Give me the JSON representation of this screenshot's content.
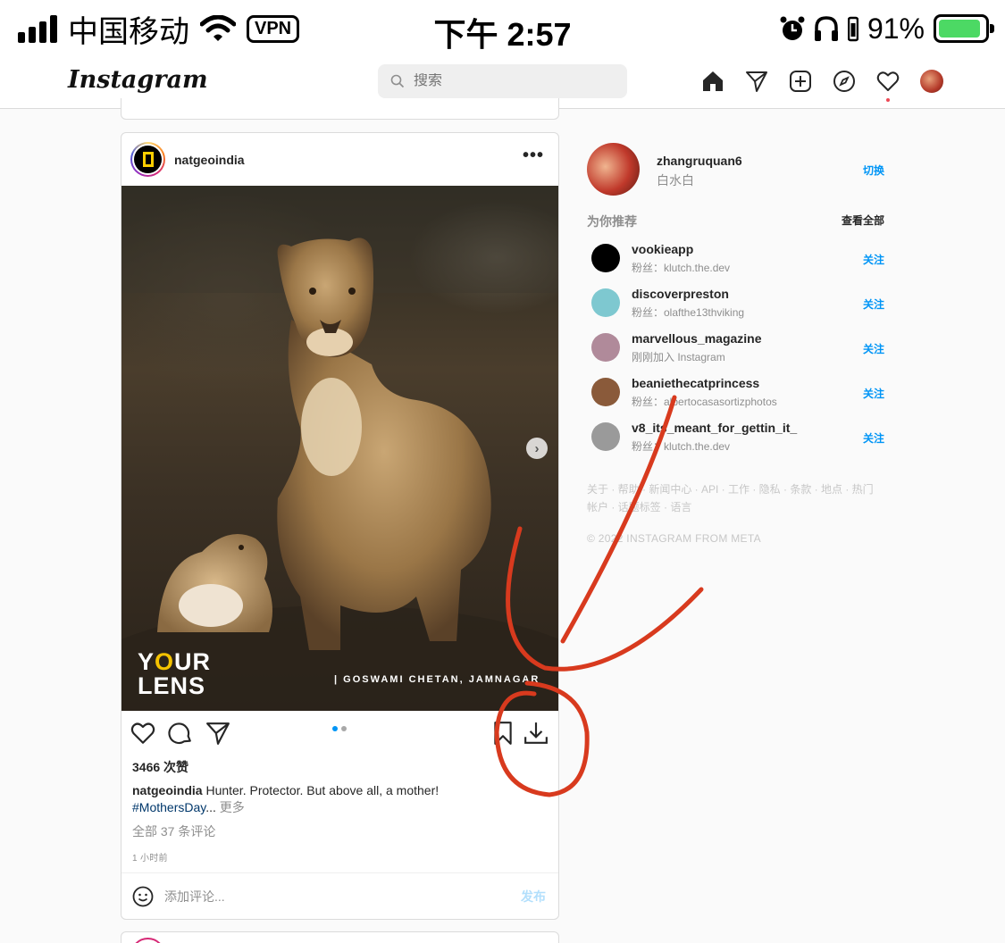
{
  "status_bar": {
    "carrier": "中国移动",
    "vpn": "VPN",
    "time": "下午 2:57",
    "battery_percent": "91%",
    "battery_level": 0.91
  },
  "header": {
    "logo": "Instagram",
    "search_placeholder": "搜索",
    "icons": [
      "home-icon",
      "direct-icon",
      "new-post-icon",
      "explore-icon",
      "activity-icon",
      "profile-avatar"
    ]
  },
  "post": {
    "username": "natgeoindia",
    "photo_credit": "| GOSWAMI CHETAN, JAMNAGAR",
    "watermark": {
      "line1_a": "Y",
      "line1_b": "O",
      "line1_c": "UR",
      "line2": "LENS"
    },
    "carousel_index": 1,
    "carousel_total": 2,
    "likes": "3466 次赞",
    "caption_user": "natgeoindia",
    "caption_text": "Hunter. Protector. But above all, a mother!",
    "hashtag": "#MothersDay",
    "ellipsis": "...",
    "more": "更多",
    "comments_link": "全部 37 条评论",
    "time_ago": "1 小时前",
    "comment_placeholder": "添加评论...",
    "publish": "发布"
  },
  "sidebar": {
    "me": {
      "username": "zhangruquan6",
      "name": "白水白",
      "switch": "切换"
    },
    "suggestions_title": "为你推荐",
    "see_all": "查看全部",
    "suggestions": [
      {
        "username": "vookieapp",
        "sub": "粉丝：klutch.the.dev",
        "action": "关注",
        "color": "#000000"
      },
      {
        "username": "discoverpreston",
        "sub": "粉丝：olafthe13thviking",
        "action": "关注",
        "color": "#7ec8d0"
      },
      {
        "username": "marvellous_magazine",
        "sub": "刚刚加入 Instagram",
        "action": "关注",
        "color": "#b08a9a"
      },
      {
        "username": "beaniethecatprincess",
        "sub": "粉丝：albertocasasortizphotos",
        "action": "关注",
        "color": "#8a5a3a"
      },
      {
        "username": "v8_its_meant_for_gettin_it_",
        "sub": "粉丝：klutch.the.dev",
        "action": "关注",
        "color": "#9a9a9a"
      }
    ],
    "footer_links": "关于 · 帮助 · 新闻中心 · API · 工作 · 隐私 · 条款 · 地点 · 热门帐户 · 话题标签 · 语言",
    "copyright": "© 2022 INSTAGRAM FROM META"
  }
}
